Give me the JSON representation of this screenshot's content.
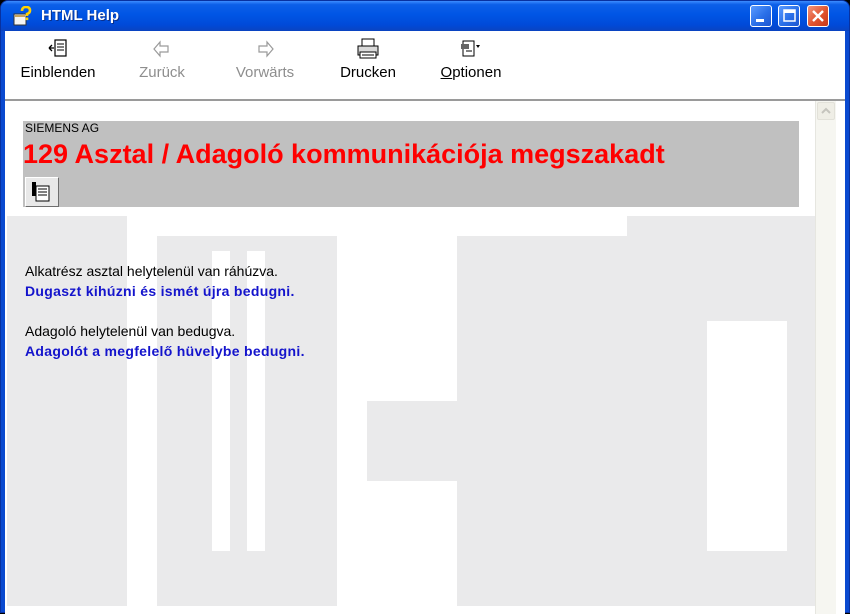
{
  "window": {
    "title": "HTML Help"
  },
  "toolbar": {
    "show_label": "Einblenden",
    "back_label": "Zurück",
    "forward_label": "Vorwärts",
    "print_label": "Drucken",
    "options_label": "Optionen",
    "options_accesskey": "O",
    "back_enabled": false,
    "forward_enabled": false
  },
  "page": {
    "company": "SIEMENS AG",
    "error_title": "129 Asztal / Adagoló kommunikációja megszakadt",
    "causes": [
      {
        "cause": "Alkatrész asztal helytelenül van ráhúzva.",
        "action": "Dugaszt kihúzni és ismét újra bedugni."
      },
      {
        "cause": "Adagoló helytelenül van bedugva.",
        "action": "Adagolót a megfelelő hüvelybe bedugni."
      }
    ]
  },
  "icons": {
    "app": "help-book-icon",
    "show": "show-tabs-icon",
    "back": "left-arrow-icon",
    "forward": "right-arrow-icon",
    "print": "printer-icon",
    "options": "options-icon",
    "related": "related-topics-icon"
  },
  "colors": {
    "title_bar": "#0055e5",
    "error_title": "#ff0000",
    "action_text": "#1414cc",
    "header_box": "#c0c0c0"
  }
}
